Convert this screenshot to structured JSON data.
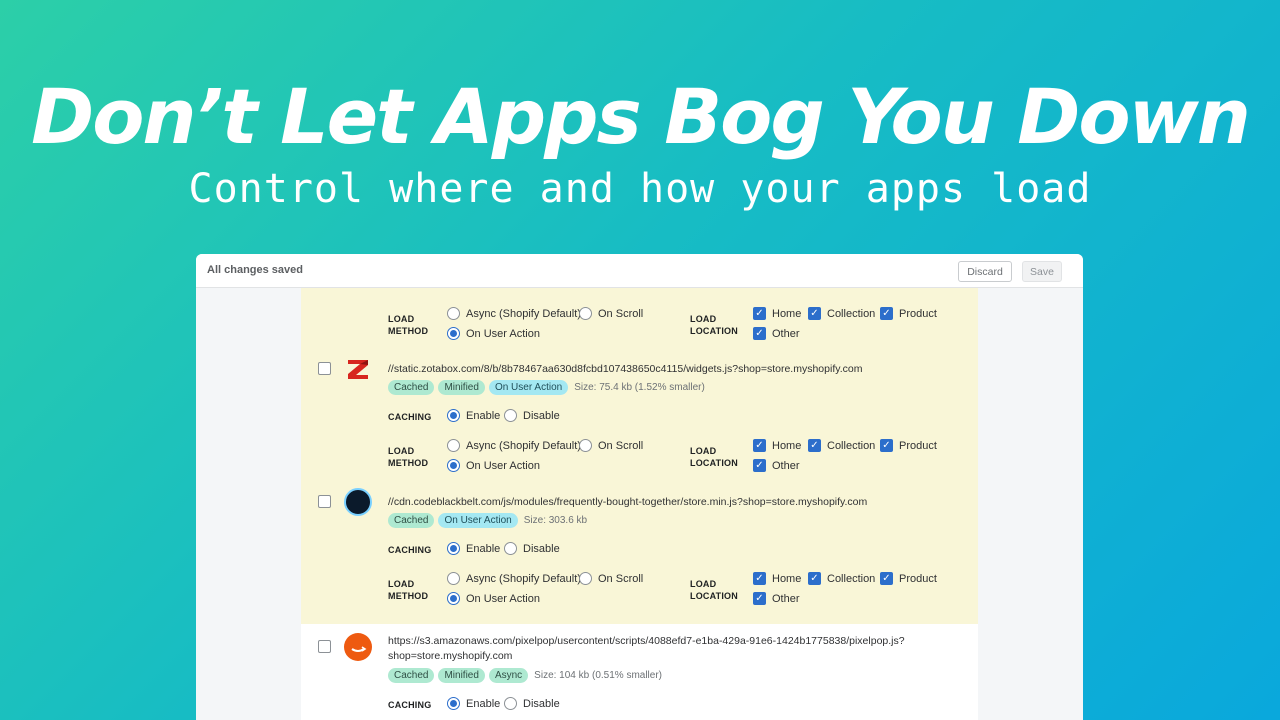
{
  "hero": {
    "title": "Don’t Let Apps Bog You Down",
    "subtitle": "Control where and how your apps load"
  },
  "topbar": {
    "status": "All changes saved",
    "discard_label": "Discard",
    "save_label": "Save"
  },
  "labels": {
    "load": "LOAD",
    "method": "METHOD",
    "location": "LOCATION",
    "caching": "CACHING"
  },
  "options": {
    "async": "Async (Shopify Default)",
    "on_scroll": "On Scroll",
    "on_user_action": "On User Action",
    "enable": "Enable",
    "disable": "Disable",
    "home": "Home",
    "collection": "Collection",
    "product": "Product",
    "other": "Other"
  },
  "scripts": [
    {
      "url": "//static.zotabox.com/8/b/8b78467aa630d8fcbd107438650c4115/widgets.js?shop=store.myshopify.com",
      "badges": [
        "Cached",
        "Minified",
        "On User Action"
      ],
      "size": "Size: 75.4 kb (1.52% smaller)"
    },
    {
      "url": "//cdn.codeblackbelt.com/js/modules/frequently-bought-together/store.min.js?shop=store.myshopify.com",
      "badges": [
        "Cached",
        "On User Action"
      ],
      "size": "Size: 303.6 kb"
    },
    {
      "url": "https://s3.amazonaws.com/pixelpop/usercontent/scripts/4088efd7-e1ba-429a-91e6-1424b1775838/pixelpop.js?shop=store.myshopify.com",
      "badges": [
        "Cached",
        "Minified",
        "Async"
      ],
      "size": "Size: 104 kb (0.51% smaller)"
    }
  ],
  "icons": {
    "check": "✓"
  }
}
